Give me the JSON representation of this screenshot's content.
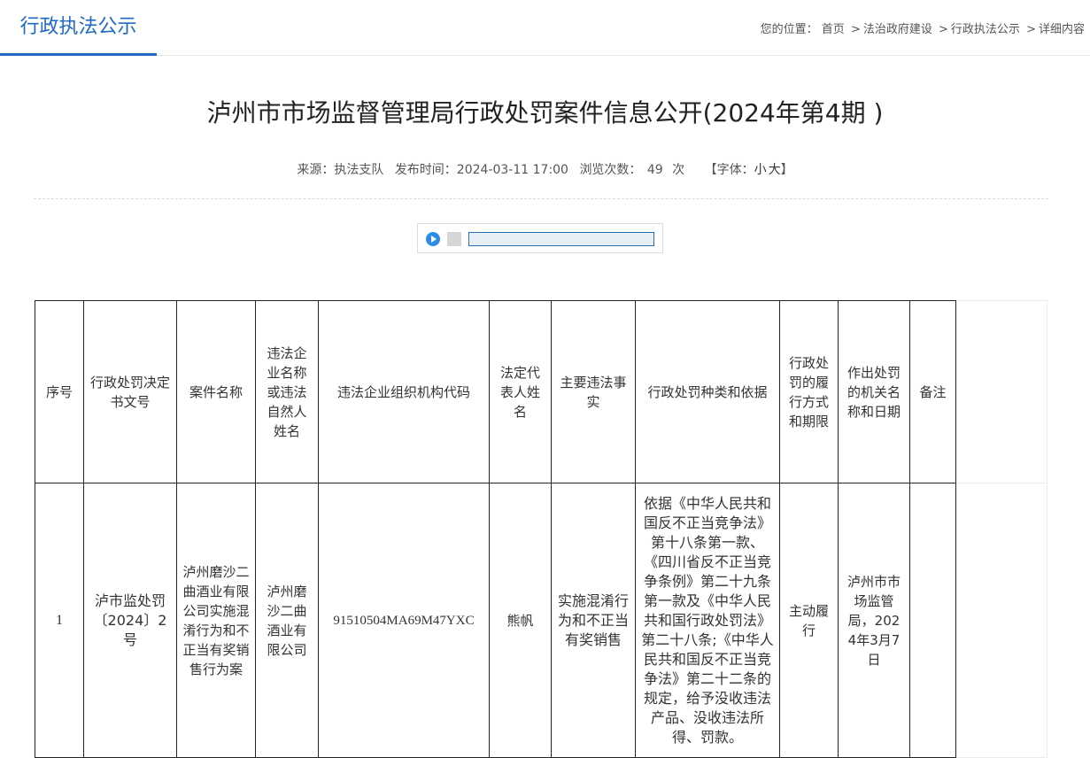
{
  "header": {
    "section_title": "行政执法公示",
    "breadcrumb": {
      "prefix": "您的位置：",
      "items": [
        "首页",
        "法治政府建设",
        "行政执法公示",
        "详细内容"
      ],
      "separator": ">"
    }
  },
  "article": {
    "title": "泸州市市场监督管理局行政处罚案件信息公开(2024年第4期 )",
    "source_label": "来源：执法支队",
    "publish_label": "发布时间：2024-03-11 17:00",
    "views_label": "浏览次数：",
    "views_count": "49",
    "views_unit": "次",
    "font_open": "【字体：",
    "font_small": "小",
    "font_large": "大",
    "font_close": "】"
  },
  "audio_player": {
    "progress": 0
  },
  "table": {
    "headers": [
      "序号",
      "行政处罚决定书文号",
      "案件名称",
      "违法企业名称或违法自然人姓名",
      "违法企业组织机构代码",
      "法定代表人姓名",
      "主要违法事实",
      "行政处罚种类和依据",
      "行政处罚的履行方式和期限",
      "作出处罚的机关名称和日期",
      "备注"
    ],
    "rows": [
      {
        "seq": "1",
        "decision_no": "泸市监处罚〔2024〕2号",
        "case_name": "泸州磨沙二曲酒业有限公司实施混淆行为和不正当有奖销售行为案",
        "party": "泸州磨沙二曲酒业有限公司",
        "org_code": "91510504MA69M47YXC",
        "legal_rep": "熊帆",
        "facts": "实施混淆行为和不正当有奖销售",
        "basis": "依据《中华人民共和国反不正当竞争法》第十八条第一款、《四川省反不正当竞争条例》第二十九条第一款及《中华人民共和国行政处罚法》第二十八条;《中华人民共和国反不正当竞争法》第二十二条的规定，给予没收违法产品、没收违法所得、罚款。",
        "performance": "主动履行",
        "authority": "泸州市市场监管局，2024年3月7日",
        "remark": ""
      }
    ]
  }
}
